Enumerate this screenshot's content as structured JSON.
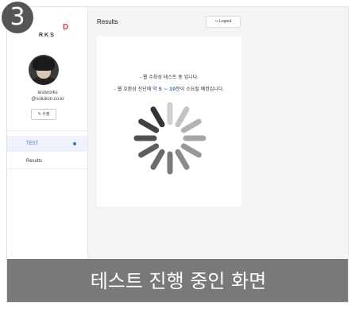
{
  "step": {
    "number": "3"
  },
  "logo": {
    "mark": "D",
    "text": "RKS"
  },
  "user": {
    "name": "testworks",
    "email": "@solution.co.kr",
    "edit_label": "수정"
  },
  "nav": {
    "items": [
      {
        "label": "TEST"
      },
      {
        "label": "Results"
      }
    ]
  },
  "header": {
    "title": "Results",
    "logout_label": "Logout"
  },
  "main": {
    "message_line1": "- 웹 수화성 테스트 중 입니다.",
    "message_line2_prefix": "- 웹 호환성 진단에 약 ",
    "message_line2_highlight": "5 ~ 10",
    "message_line2_suffix": "분이 소요될 예정입니다."
  },
  "caption": {
    "text": "테스트 진행 중인 화면"
  },
  "colors": {
    "accent": "#3b6fd8",
    "caption_bg": "#6e6e6e",
    "spinner": "#333333"
  }
}
